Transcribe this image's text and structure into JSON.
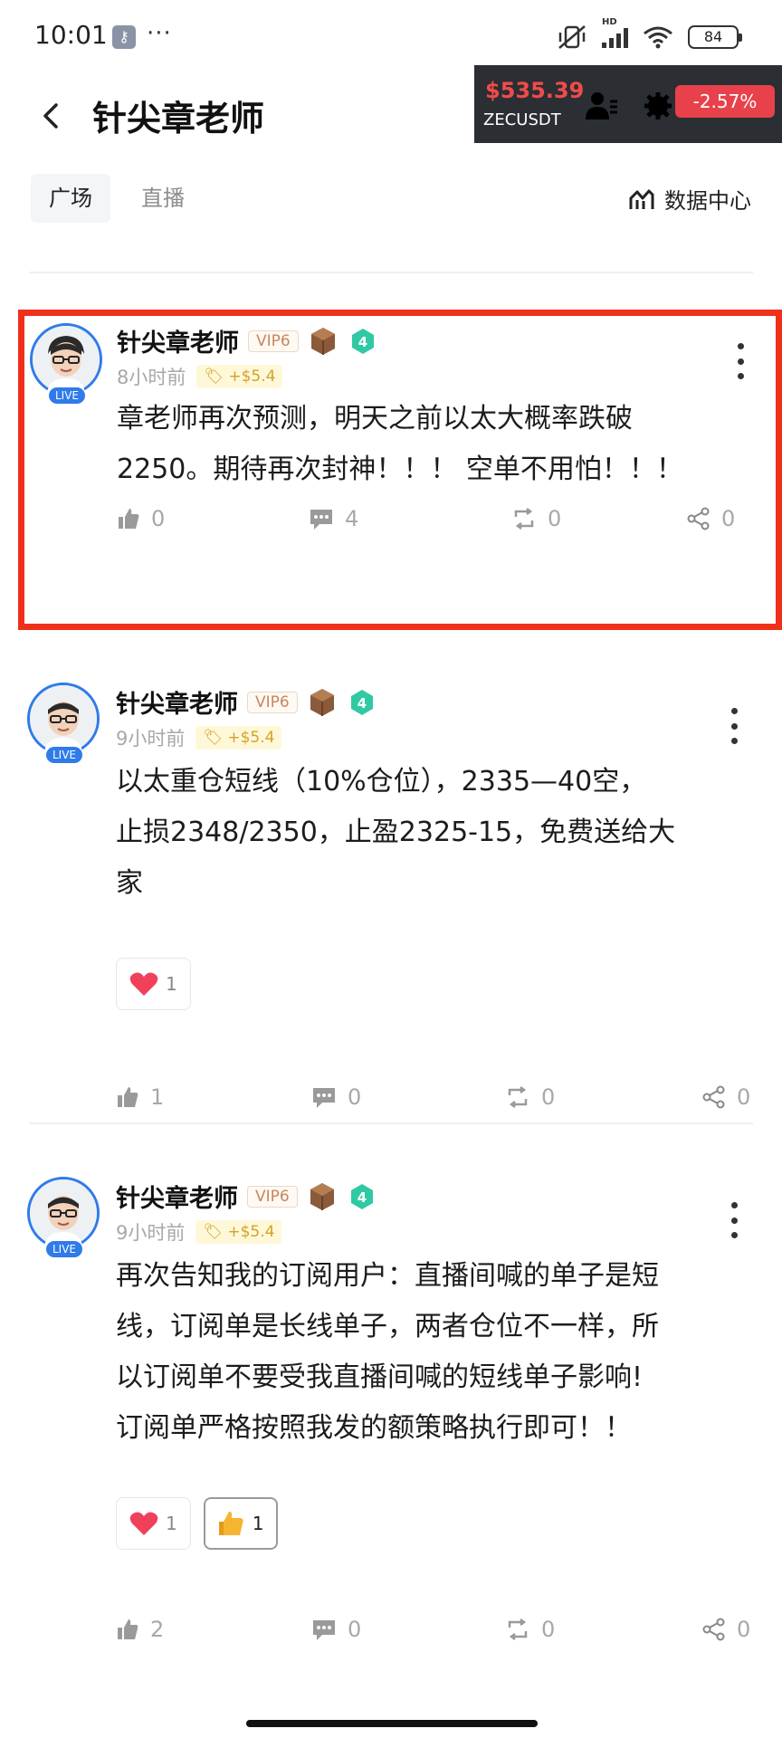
{
  "status_bar": {
    "time": "10:01",
    "overflow": "···",
    "battery": "84",
    "net_tag": "HD"
  },
  "header": {
    "title": "针尖章老师"
  },
  "ticker": {
    "price": "$535.39",
    "symbol": "ZECUSDT",
    "change": "-2.57%"
  },
  "tabs": [
    {
      "label": "广场"
    },
    {
      "label": "直播"
    }
  ],
  "data_center": {
    "label": "数据中心"
  },
  "posts": [
    {
      "author": "针尖章老师",
      "vip": "VIP6",
      "level": "4",
      "live": "LIVE",
      "time": "8小时前",
      "earn": "+$5.4",
      "content": "章老师再次预测，明天之前以太大概率跌破\n2250。期待再次封神！！！ 空单不用怕！！！",
      "reactions": [],
      "likes": "0",
      "comments": "4",
      "reposts": "0",
      "shares": "0"
    },
    {
      "author": "针尖章老师",
      "vip": "VIP6",
      "level": "4",
      "live": "LIVE",
      "time": "9小时前",
      "earn": "+$5.4",
      "content": "以太重仓短线（10%仓位），2335—40空，\n止损2348/2350，止盈2325-15，免费送给大\n家",
      "reactions": [
        {
          "icon": "heart-icon",
          "count": "1"
        }
      ],
      "likes": "1",
      "comments": "0",
      "reposts": "0",
      "shares": "0"
    },
    {
      "author": "针尖章老师",
      "vip": "VIP6",
      "level": "4",
      "live": "LIVE",
      "time": "9小时前",
      "earn": "+$5.4",
      "content": "再次告知我的订阅用户：直播间喊的单子是短\n线，订阅单是长线单子，两者仓位不一样，所\n以订阅单不要受我直播间喊的短线单子影响!\n订阅单严格按照我发的额策略执行即可！！",
      "reactions": [
        {
          "icon": "heart-icon",
          "count": "1"
        },
        {
          "icon": "thumbs-up-emoji-icon",
          "count": "1"
        }
      ],
      "likes": "2",
      "comments": "0",
      "reposts": "0",
      "shares": "0"
    }
  ],
  "colors": {
    "accent": "#2f7bea",
    "highlight": "#f0301a",
    "ticker_bg": "#2b2e33",
    "negative": "#e8414b"
  }
}
